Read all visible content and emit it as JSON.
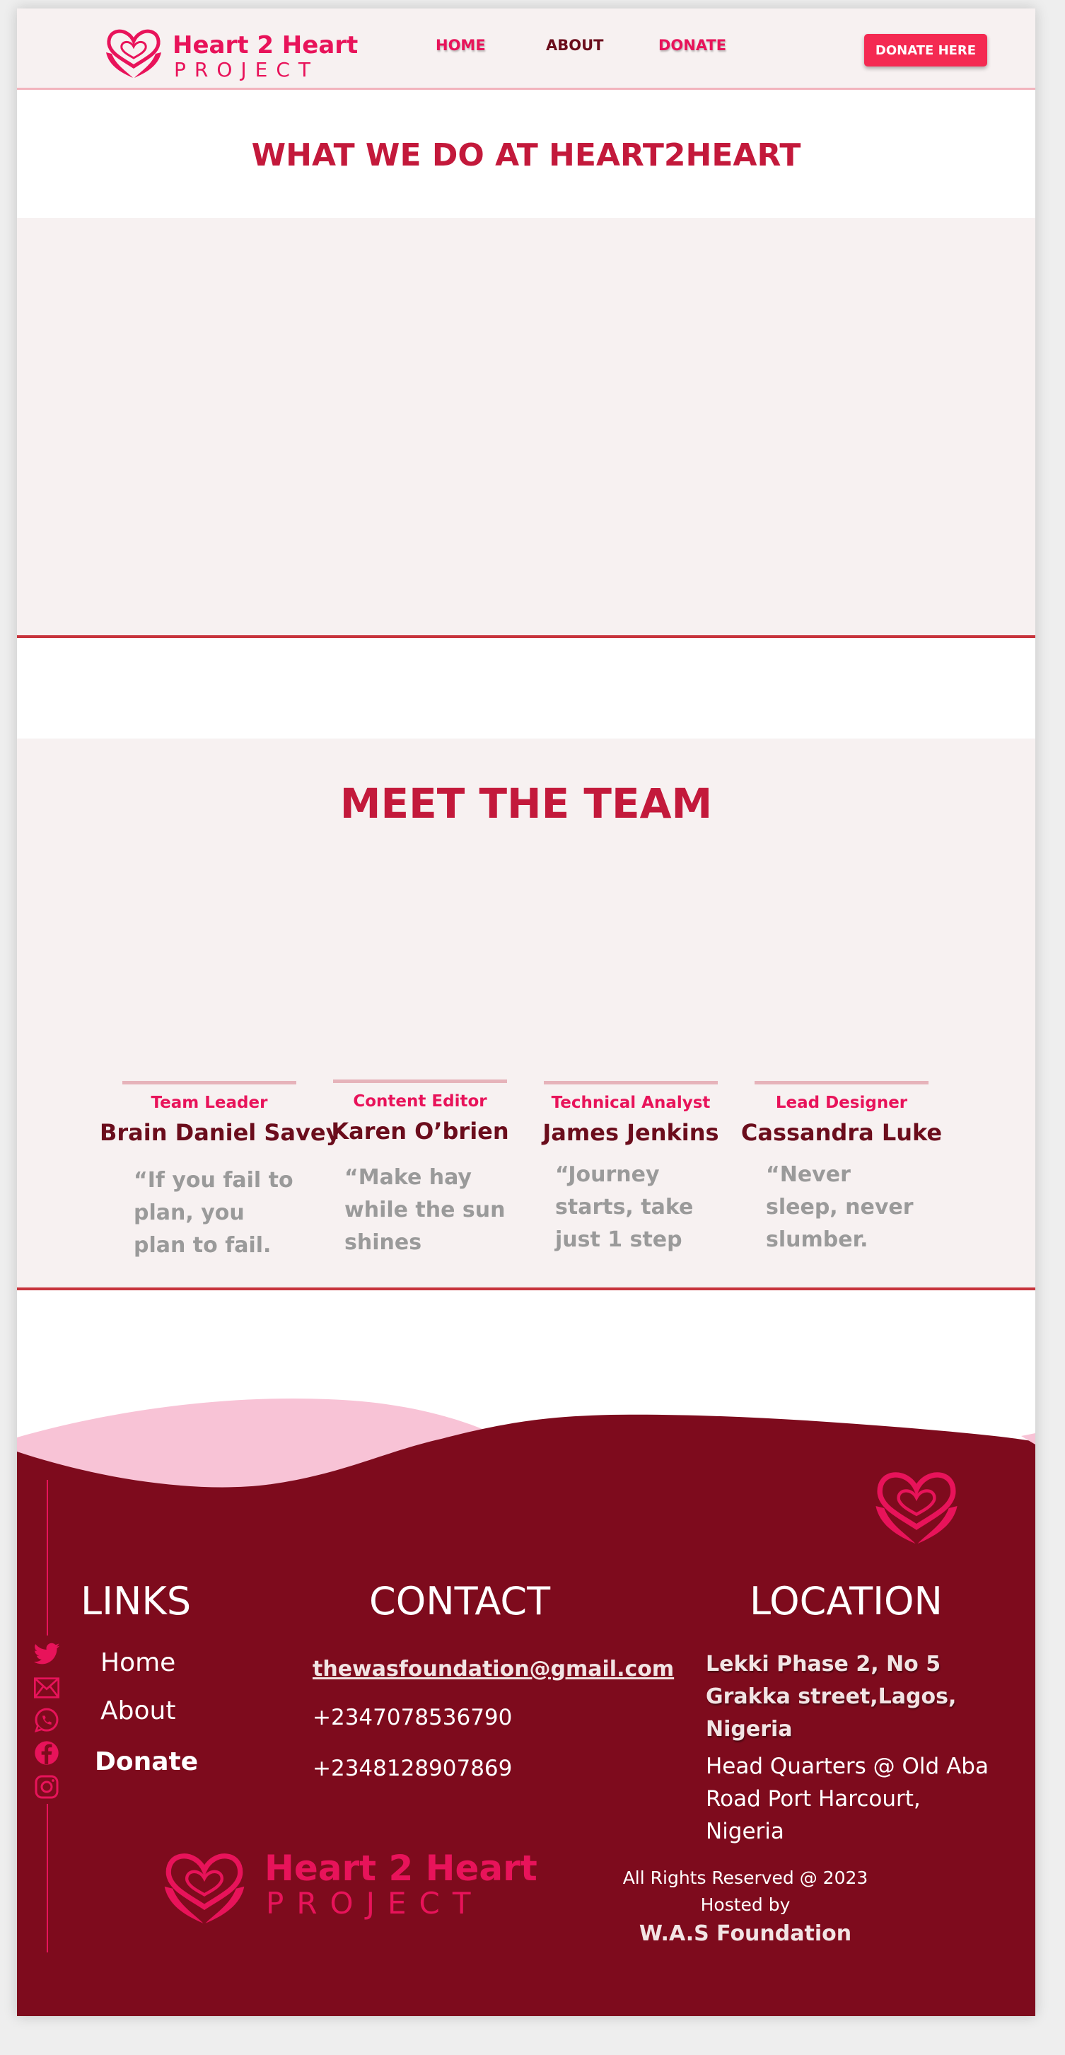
{
  "header": {
    "logo": {
      "word1": "Heart 2 Heart",
      "word2": "PROJECT"
    },
    "nav": [
      {
        "label": "HOME"
      },
      {
        "label": "ABOUT"
      },
      {
        "label": "DONATE"
      }
    ],
    "donate_button": "DONATE HERE"
  },
  "what_we_do": {
    "title": "WHAT WE DO AT HEART2HEART"
  },
  "team": {
    "title": "MEET THE TEAM",
    "members": [
      {
        "role": "Team Leader",
        "name": "Brain Daniel Savey",
        "quote": "“If you fail to plan, you plan to fail."
      },
      {
        "role": "Content Editor",
        "name": "Karen O’brien",
        "quote": "“Make hay while the sun shines"
      },
      {
        "role": "Technical Analyst",
        "name": "James Jenkins",
        "quote": "“Journey starts, take just 1 step"
      },
      {
        "role": "Lead Designer",
        "name": "Cassandra Luke",
        "quote": "“Never sleep, never slumber."
      }
    ]
  },
  "footer": {
    "social_icons": [
      "twitter-icon",
      "mail-icon",
      "whatsapp-icon",
      "facebook-icon",
      "instagram-icon"
    ],
    "links": {
      "heading": "LINKS",
      "items": [
        "Home",
        "About",
        "Donate"
      ]
    },
    "contact": {
      "heading": "CONTACT",
      "email": "thewasfoundation@gmail.com",
      "phones": [
        "+2347078536790",
        "+2348128907869"
      ]
    },
    "location": {
      "heading": "LOCATION",
      "address_bold": "Lekki Phase 2, No 5 Grakka street,Lagos, Nigeria",
      "address": "Head Quarters @ Old Aba Road Port Harcourt, Nigeria"
    },
    "logo": {
      "word1": "Heart 2 Heart",
      "word2": "PROJECT"
    },
    "rights": "All Rights Reserved @ 2023",
    "hosted": "Hosted by",
    "host_name": "W.A.S Foundation"
  },
  "colors": {
    "brand_pink": "#e8135a",
    "title_red": "#c3193b",
    "footer_maroon": "#7e0b1d",
    "button_red": "#f42a52",
    "panel_bg": "#f7f1f1",
    "wave_pink": "#f8c3d6"
  }
}
